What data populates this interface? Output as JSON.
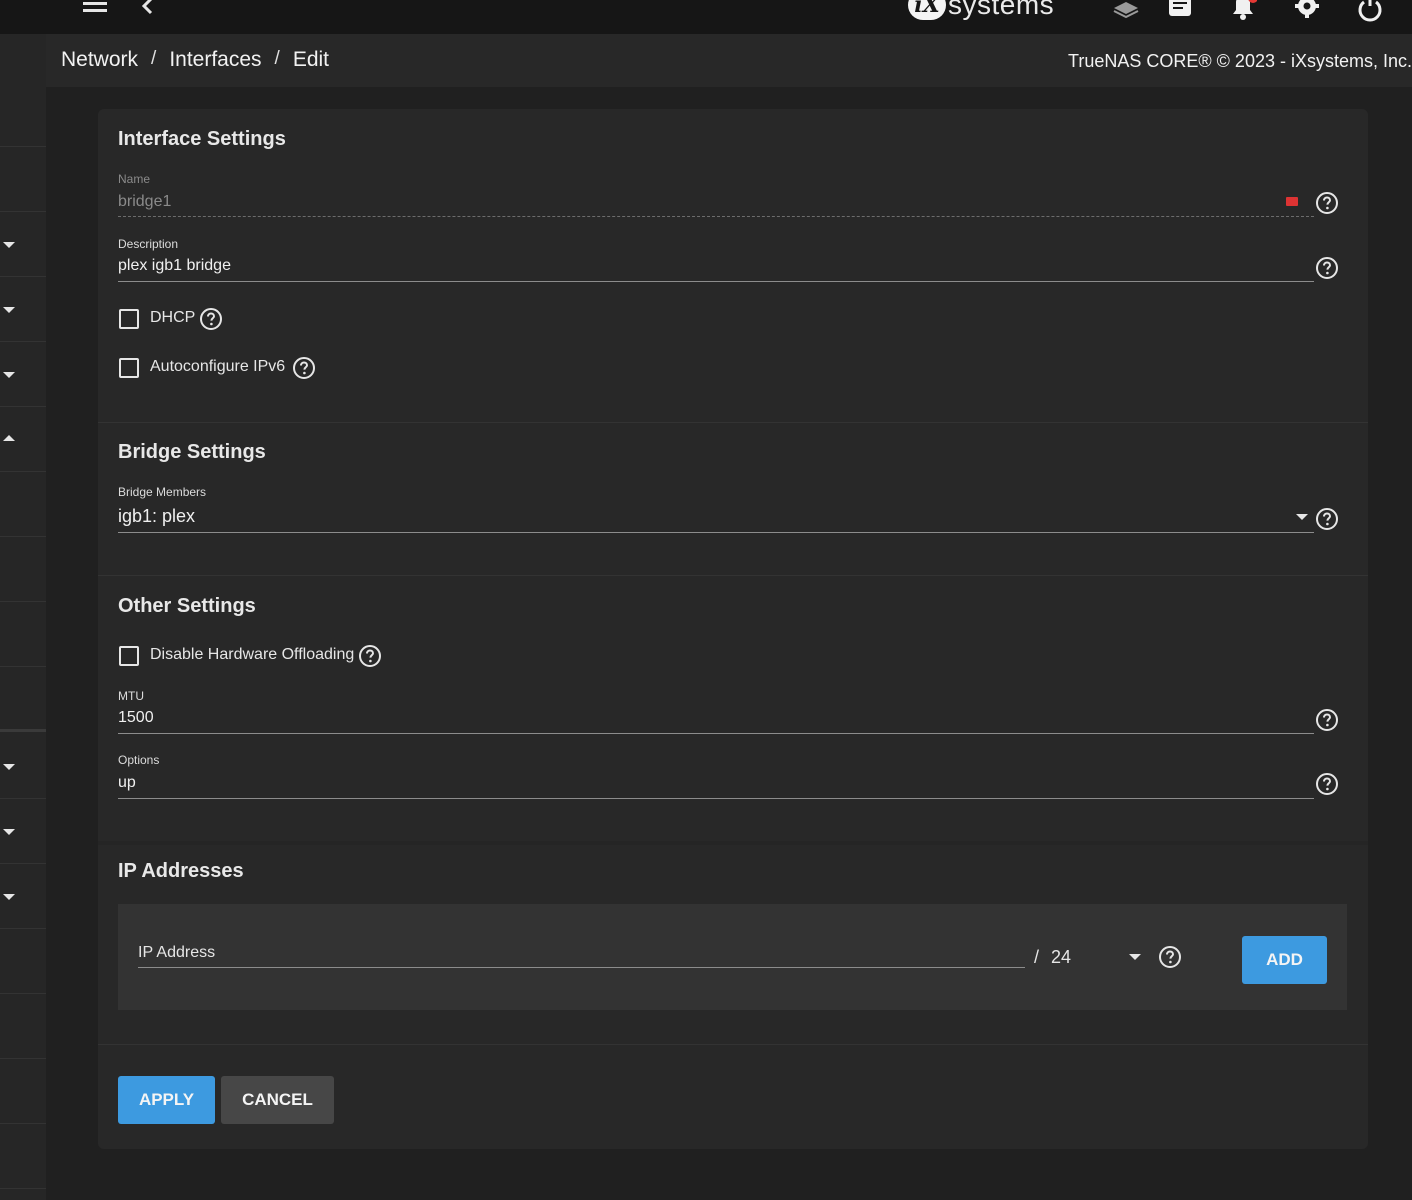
{
  "topbar": {
    "logo_mark": "iX",
    "logo_text": "systems",
    "icons": [
      "menu-icon",
      "back-icon",
      "truecommand-icon",
      "tasks-icon",
      "notifications-icon",
      "settings-icon",
      "power-icon"
    ],
    "notification_color": "#e53935"
  },
  "header": {
    "breadcrumb": [
      "Network",
      "Interfaces",
      "Edit"
    ],
    "copyright": "TrueNAS CORE® © 2023 - iXsystems, Inc."
  },
  "interface_settings": {
    "title": "Interface Settings",
    "name_label": "Name",
    "name_value": "bridge1",
    "description_label": "Description",
    "description_value": "plex igb1 bridge",
    "dhcp_label": "DHCP",
    "dhcp_checked": false,
    "autoconf_label": "Autoconfigure IPv6",
    "autoconf_checked": false
  },
  "bridge_settings": {
    "title": "Bridge Settings",
    "members_label": "Bridge Members",
    "members_value": "igb1: plex"
  },
  "other_settings": {
    "title": "Other Settings",
    "offload_label": "Disable Hardware Offloading",
    "offload_checked": false,
    "mtu_label": "MTU",
    "mtu_value": "1500",
    "options_label": "Options",
    "options_value": "up"
  },
  "ip_addresses": {
    "title": "IP Addresses",
    "ip_placeholder": "IP Address",
    "slash": "/",
    "netmask": "24",
    "add_label": "ADD"
  },
  "actions": {
    "apply_label": "APPLY",
    "cancel_label": "CANCEL"
  },
  "colors": {
    "accent": "#3d9ae0",
    "background": "#202020",
    "card": "#282828"
  }
}
